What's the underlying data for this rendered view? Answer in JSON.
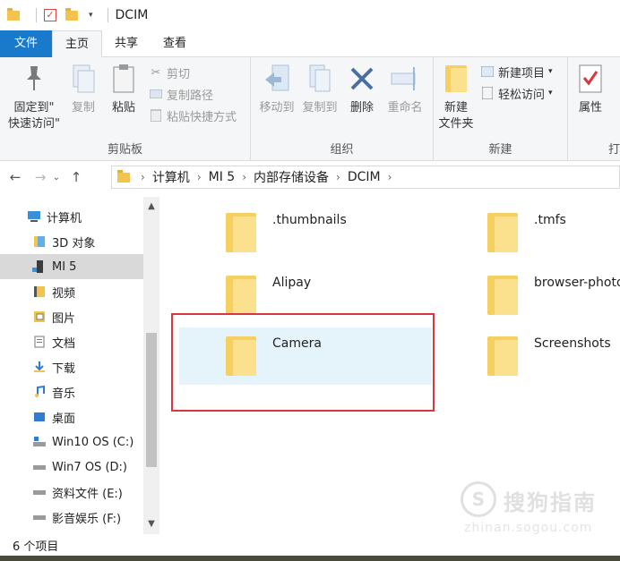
{
  "titlebar": {
    "title": "DCIM"
  },
  "tabs": [
    {
      "label": "文件"
    },
    {
      "label": "主页"
    },
    {
      "label": "共享"
    },
    {
      "label": "查看"
    }
  ],
  "ribbon": {
    "clipboard": {
      "group_label": "剪贴板",
      "pin_label_line1": "固定到\"",
      "pin_label_line2": "快速访问\"",
      "copy_label": "复制",
      "paste_label": "粘贴",
      "cut_label": "剪切",
      "copy_path_label": "复制路径",
      "paste_shortcut_label": "粘贴快捷方式"
    },
    "organize": {
      "group_label": "组织",
      "move_to_label": "移动到",
      "copy_to_label": "复制到",
      "delete_label": "删除",
      "rename_label": "重命名"
    },
    "new": {
      "group_label": "新建",
      "new_folder_line1": "新建",
      "new_folder_line2": "文件夹",
      "new_item_label": "新建项目",
      "easy_access_label": "轻松访问"
    },
    "open": {
      "properties_label": "属性",
      "partial_label": "打"
    }
  },
  "address": {
    "crumbs": [
      "计算机",
      "MI 5",
      "内部存储设备",
      "DCIM"
    ]
  },
  "nav": {
    "items": [
      {
        "label": "计算机"
      },
      {
        "label": "3D 对象"
      },
      {
        "label": "MI 5"
      },
      {
        "label": "视频"
      },
      {
        "label": "图片"
      },
      {
        "label": "文档"
      },
      {
        "label": "下载"
      },
      {
        "label": "音乐"
      },
      {
        "label": "桌面"
      },
      {
        "label": "Win10 OS (C:)"
      },
      {
        "label": "Win7 OS (D:)"
      },
      {
        "label": "资料文件 (E:)"
      },
      {
        "label": "影音娱乐 (F:)"
      }
    ]
  },
  "files": [
    {
      "name": ".thumbnails"
    },
    {
      "name": ".tmfs"
    },
    {
      "name": "Alipay"
    },
    {
      "name": "browser-photo"
    },
    {
      "name": "Camera"
    },
    {
      "name": "Screenshots"
    }
  ],
  "status": {
    "item_count": "6 个项目"
  },
  "watermark": {
    "logo_char": "S",
    "text": "搜狗指南",
    "url": "zhinan.sogou.com"
  },
  "colors": {
    "file_tab": "#1979ca",
    "selection": "#e5f3fb",
    "highlight_box": "#d9363e",
    "folder": "#f6cf61"
  }
}
